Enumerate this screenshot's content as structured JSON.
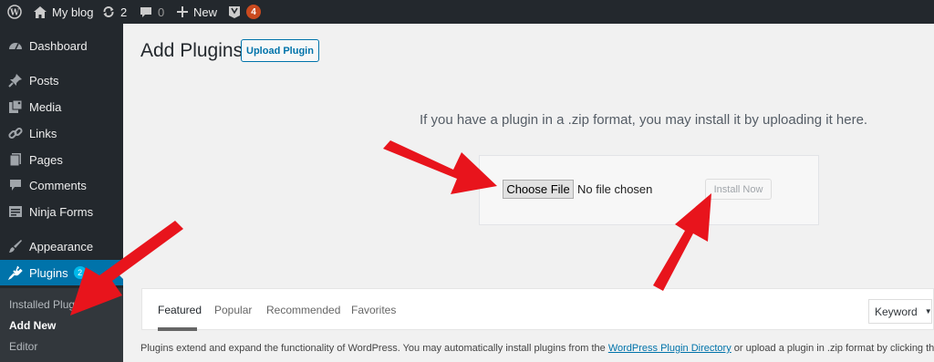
{
  "admin_bar": {
    "site_name": "My blog",
    "updates_count": "2",
    "comments_count": "0",
    "new_label": "New",
    "yoast_count": "4"
  },
  "sidebar": {
    "items": [
      {
        "label": "Dashboard",
        "icon": "dashboard-icon"
      },
      {
        "label": "Posts",
        "icon": "pin-icon"
      },
      {
        "label": "Media",
        "icon": "media-icon"
      },
      {
        "label": "Links",
        "icon": "link-icon"
      },
      {
        "label": "Pages",
        "icon": "pages-icon"
      },
      {
        "label": "Comments",
        "icon": "comment-icon"
      },
      {
        "label": "Ninja Forms",
        "icon": "forms-icon"
      },
      {
        "label": "Appearance",
        "icon": "brush-icon"
      },
      {
        "label": "Plugins",
        "icon": "plugin-icon",
        "badge": "2"
      }
    ],
    "submenu": [
      "Installed Plugins",
      "Add New",
      "Editor"
    ]
  },
  "main": {
    "title": "Add Plugins",
    "upload_button": "Upload Plugin",
    "upload_help": "If you have a plugin in a .zip format, you may install it by uploading it here.",
    "choose_file_label": "Choose File",
    "no_file_text": "No file chosen",
    "install_now_label": "Install Now",
    "filter_tabs": [
      "Featured",
      "Popular",
      "Recommended",
      "Favorites"
    ],
    "search_type": "Keyword",
    "description_pre": "Plugins extend and expand the functionality of WordPress. You may automatically install plugins from the ",
    "description_link": "WordPress Plugin Directory",
    "description_post": " or upload a plugin in .zip format by clicking the b"
  },
  "colors": {
    "admin_bg": "#23282d",
    "accent": "#0073aa",
    "arrow": "#e8141c"
  }
}
